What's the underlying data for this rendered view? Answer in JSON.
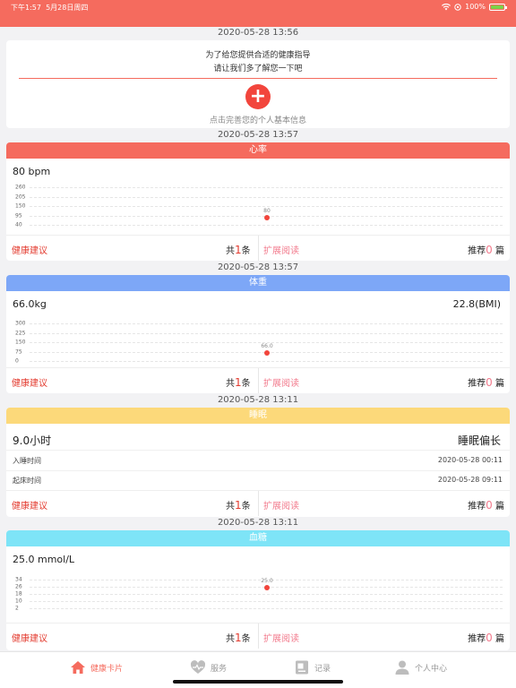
{
  "status_bar": {
    "time": "下午1:57",
    "date": "5月28日周四",
    "battery": "100%",
    "colors": {
      "bar": "#f56b5e",
      "battery_fill": "#7cd34a"
    }
  },
  "profile_card": {
    "timestamp": "2020-05-28 13:56",
    "line1": "为了给您提供合适的健康指导",
    "line2": "请让我们多了解您一下吧",
    "add_icon": "plus-icon",
    "hint": "点击完善您的个人基本信息"
  },
  "cards": [
    {
      "timestamp": "2020-05-28 13:57",
      "title": "心率",
      "color": "#f56b5e",
      "value": "80 bpm",
      "value_right": "",
      "chart_data": {
        "type": "scatter",
        "y_ticks": [
          "260",
          "205",
          "150",
          "95",
          "40"
        ],
        "ylim": [
          40,
          260
        ],
        "points": [
          {
            "y": 80,
            "label": "80"
          }
        ]
      },
      "advice_label": "健康建议",
      "count_prefix": "共",
      "count_num": "1",
      "count_suffix": "条",
      "ext_label": "扩展阅读",
      "rec_prefix": "推荐",
      "rec_num": "0",
      "rec_suffix": "篇"
    },
    {
      "timestamp": "2020-05-28 13:57",
      "title": "体重",
      "color": "#7da7f7",
      "value": "66.0kg",
      "value_right": "22.8(BMI)",
      "chart_data": {
        "type": "scatter",
        "y_ticks": [
          "300",
          "225",
          "150",
          "75",
          "0"
        ],
        "ylim": [
          0,
          300
        ],
        "points": [
          {
            "y": 66.0,
            "label": "66.0"
          }
        ]
      },
      "advice_label": "健康建议",
      "count_prefix": "共",
      "count_num": "1",
      "count_suffix": "条",
      "ext_label": "扩展阅读",
      "rec_prefix": "推荐",
      "rec_num": "0",
      "rec_suffix": "篇"
    },
    {
      "timestamp": "2020-05-28 13:11",
      "title": "睡眠",
      "color": "#fcd97a",
      "value": "9.0小时",
      "value_right": "睡眠偏长",
      "rows": [
        {
          "label": "入睡时间",
          "value": "2020-05-28 00:11"
        },
        {
          "label": "起床时间",
          "value": "2020-05-28 09:11"
        }
      ],
      "advice_label": "健康建议",
      "count_prefix": "共",
      "count_num": "1",
      "count_suffix": "条",
      "ext_label": "扩展阅读",
      "rec_prefix": "推荐",
      "rec_num": "0",
      "rec_suffix": "篇"
    },
    {
      "timestamp": "2020-05-28 13:11",
      "title": "血糖",
      "color": "#7ee4f7",
      "value": "25.0 mmol/L",
      "value_right": "",
      "chart_data": {
        "type": "scatter",
        "y_ticks": [
          "34",
          "26",
          "18",
          "10",
          "2"
        ],
        "ylim": [
          2,
          34
        ],
        "points": [
          {
            "y": 25.0,
            "label": "25.0"
          }
        ]
      },
      "advice_label": "健康建议",
      "count_prefix": "共",
      "count_num": "1",
      "count_suffix": "条",
      "ext_label": "扩展阅读",
      "rec_prefix": "推荐",
      "rec_num": "0",
      "rec_suffix": "篇"
    }
  ],
  "tabbar": {
    "tabs": [
      {
        "label": "健康卡片",
        "icon": "home-icon",
        "active": true
      },
      {
        "label": "服务",
        "icon": "heart-icon",
        "active": false
      },
      {
        "label": "记录",
        "icon": "record-icon",
        "active": false
      },
      {
        "label": "个人中心",
        "icon": "person-icon",
        "active": false
      }
    ],
    "active_color": "#f56b5e"
  }
}
